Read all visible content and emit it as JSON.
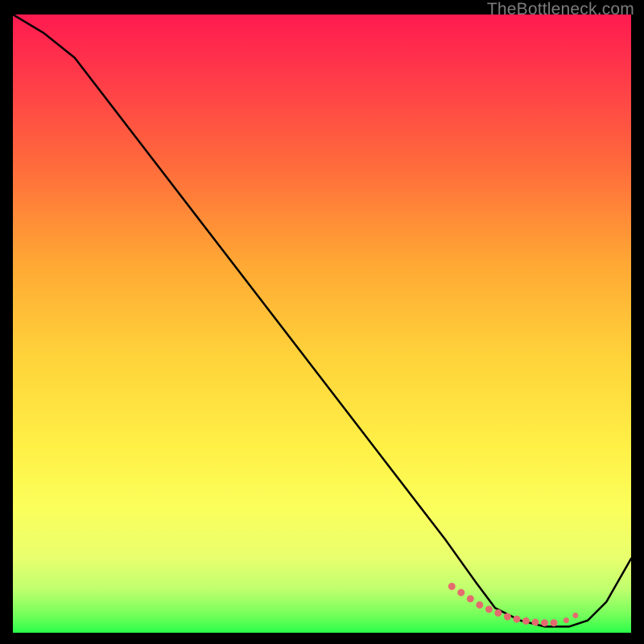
{
  "watermark": "TheBottleneck.com",
  "chart_data": {
    "type": "line",
    "title": "",
    "xlabel": "",
    "ylabel": "",
    "xlim": [
      0,
      100
    ],
    "ylim": [
      0,
      100
    ],
    "series": [
      {
        "name": "curve",
        "x": [
          0,
          5,
          10,
          20,
          30,
          40,
          50,
          60,
          70,
          75,
          78,
          82,
          86,
          90,
          93,
          96,
          100
        ],
        "values": [
          100,
          97,
          93,
          80,
          67,
          54,
          41,
          28,
          15,
          8,
          4,
          2,
          1,
          1,
          2,
          5,
          12
        ]
      }
    ],
    "markers": {
      "color": "#e46a6f",
      "x": [
        71,
        72.5,
        74,
        75.5,
        77,
        78.5,
        80,
        81.5,
        83,
        84.5,
        86,
        87.5,
        89.5,
        91
      ],
      "values": [
        7.5,
        6.5,
        5.5,
        4.5,
        3.8,
        3.2,
        2.6,
        2.2,
        1.9,
        1.7,
        1.6,
        1.6,
        2.0,
        2.8
      ],
      "radius": [
        4.5,
        4.5,
        4.5,
        4.5,
        4.5,
        4.5,
        4.5,
        4.5,
        4.5,
        4.5,
        4.5,
        4.5,
        3.5,
        3.5
      ]
    }
  }
}
